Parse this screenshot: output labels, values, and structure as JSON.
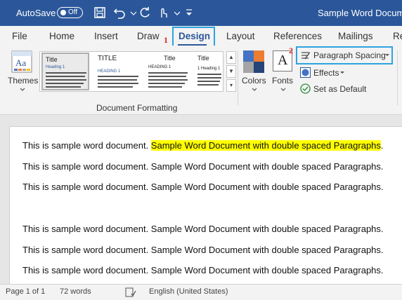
{
  "titlebar": {
    "autosave_label": "AutoSave",
    "autosave_state": "Off",
    "doc_title": "Sample Word Document"
  },
  "tabs": [
    {
      "label": "File"
    },
    {
      "label": "Home"
    },
    {
      "label": "Insert"
    },
    {
      "label": "Draw"
    },
    {
      "label": "Design"
    },
    {
      "label": "Layout"
    },
    {
      "label": "References"
    },
    {
      "label": "Mailings"
    },
    {
      "label": "Re"
    }
  ],
  "active_tab": "Design",
  "markers": {
    "step1": "1",
    "step2": "2"
  },
  "ribbon": {
    "themes_label": "Themes",
    "group_label": "Document Formatting",
    "colors_label": "Colors",
    "fonts_label": "Fonts",
    "fonts_glyph": "A",
    "themes_glyph": "Aa",
    "paragraph_spacing": "Paragraph Spacing",
    "effects": "Effects",
    "set_default": "Set as Default",
    "thumbs": [
      {
        "title": "Title",
        "heading": "Heading 1"
      },
      {
        "title": "TITLE",
        "heading": "HEADING 1"
      },
      {
        "title": "Title",
        "heading": "HEADING 1"
      },
      {
        "title": "Title",
        "heading": "1 Heading 1"
      }
    ]
  },
  "document": {
    "paragraphs": [
      {
        "plain": "This is sample word document. ",
        "highlight": "Sample Word Document with double spaced Paragraphs",
        "tail": "."
      },
      {
        "plain": "This is sample word document. Sample Word Document with double spaced Paragraphs.",
        "highlight": "",
        "tail": ""
      },
      {
        "plain": "This is sample word document. Sample Word Document with double spaced Paragraphs.",
        "highlight": "",
        "tail": ""
      },
      {
        "plain": "This is sample word document. Sample Word Document with double spaced Paragraphs.",
        "highlight": "",
        "tail": ""
      },
      {
        "plain": "This is sample word document. Sample Word Document with double spaced Paragraphs.",
        "highlight": "",
        "tail": ""
      },
      {
        "plain": "This is sample word document. Sample Word Document with double spaced Paragraphs.",
        "highlight": "",
        "tail": ""
      }
    ],
    "highlight_color": "#ffff00"
  },
  "status": {
    "page": "Page 1 of 1",
    "words": "72 words",
    "language": "English (United States)"
  },
  "colors": {
    "titlebar": "#2b579a",
    "accent_box": "#2ea3e0",
    "marker": "#e02020"
  }
}
